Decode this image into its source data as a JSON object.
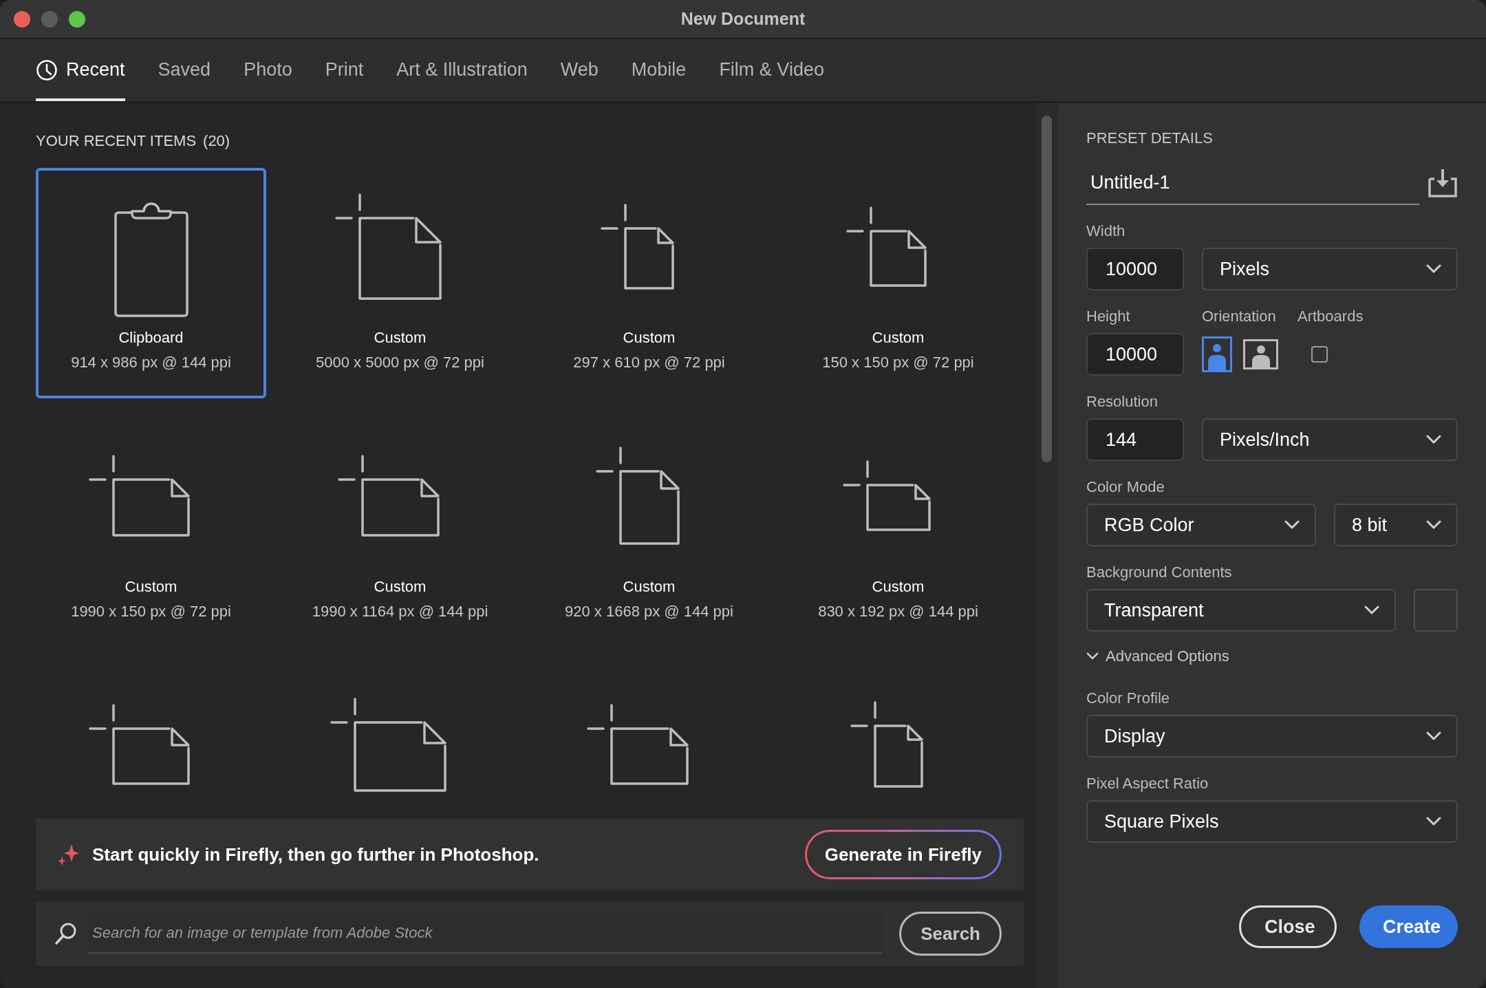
{
  "window": {
    "title": "New Document"
  },
  "tabs": [
    {
      "label": "Recent",
      "selected": true,
      "kind": "recent"
    },
    {
      "label": "Saved",
      "selected": false
    },
    {
      "label": "Photo",
      "selected": false
    },
    {
      "label": "Print",
      "selected": false
    },
    {
      "label": "Art & Illustration",
      "selected": false
    },
    {
      "label": "Web",
      "selected": false
    },
    {
      "label": "Mobile",
      "selected": false
    },
    {
      "label": "Film & Video",
      "selected": false
    }
  ],
  "recent": {
    "heading": "YOUR RECENT ITEMS",
    "count": "(20)",
    "items": [
      {
        "kind": "clipboard",
        "name": "Clipboard",
        "size": "914 x 986 px @ 144 ppi",
        "selected": true
      },
      {
        "kind": "custom",
        "name": "Custom",
        "size": "5000 x 5000 px @ 72 ppi",
        "selected": false
      },
      {
        "kind": "custom",
        "name": "Custom",
        "size": "297 x 610 px @ 72 ppi",
        "selected": false
      },
      {
        "kind": "custom",
        "name": "Custom",
        "size": "150 x 150 px @ 72 ppi",
        "selected": false
      },
      {
        "kind": "custom",
        "name": "Custom",
        "size": "1990 x 150 px @ 72 ppi",
        "selected": false
      },
      {
        "kind": "custom",
        "name": "Custom",
        "size": "1990 x 1164 px @ 144 ppi",
        "selected": false
      },
      {
        "kind": "custom",
        "name": "Custom",
        "size": "920 x 1668 px @ 144 ppi",
        "selected": false
      },
      {
        "kind": "custom",
        "name": "Custom",
        "size": "830 x 192 px @ 144 ppi",
        "selected": false
      },
      {
        "kind": "custom",
        "selected": false
      },
      {
        "kind": "custom",
        "selected": false
      },
      {
        "kind": "custom",
        "selected": false
      },
      {
        "kind": "custom",
        "selected": false
      }
    ]
  },
  "firefly_banner": {
    "message": "Start quickly in Firefly, then go further in Photoshop.",
    "button": "Generate in Firefly"
  },
  "stock_search": {
    "placeholder": "Search for an image or template from Adobe Stock",
    "button": "Search"
  },
  "preset": {
    "heading": "PRESET DETAILS",
    "name": "Untitled-1",
    "width": {
      "label": "Width",
      "value": "10000",
      "unit": "Pixels"
    },
    "height": {
      "label": "Height",
      "value": "10000"
    },
    "orientation": {
      "label": "Orientation",
      "options": [
        {
          "kind": "portrait",
          "selected": true
        },
        {
          "kind": "landscape",
          "selected": false
        }
      ]
    },
    "artboards": {
      "label": "Artboards",
      "checked": false
    },
    "resolution": {
      "label": "Resolution",
      "value": "144",
      "unit": "Pixels/Inch"
    },
    "color_mode": {
      "label": "Color Mode",
      "value": "RGB Color",
      "depth": "8 bit"
    },
    "background": {
      "label": "Background Contents",
      "value": "Transparent"
    },
    "advanced": {
      "label": "Advanced Options",
      "expanded": true
    },
    "color_profile": {
      "label": "Color Profile",
      "value": "Display"
    },
    "pixel_aspect_ratio": {
      "label": "Pixel Aspect Ratio",
      "value": "Square Pixels"
    }
  },
  "buttons": [
    {
      "label": "Close",
      "kind": "secondary"
    },
    {
      "label": "Create",
      "kind": "primary"
    }
  ]
}
